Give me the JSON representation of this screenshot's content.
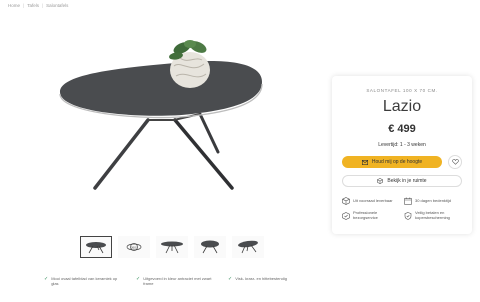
{
  "breadcrumb": [
    "Home",
    "Tafels",
    "Salontafels"
  ],
  "product": {
    "subtitle": "SALONTAFEL 100 X 70 CM.",
    "title": "Lazio",
    "price": "€ 499",
    "delivery": "Levertijd: 1 - 3 weken"
  },
  "actions": {
    "notify_label": "Houd mij op de hoogte",
    "room_label": "Bekijk in je ruimte"
  },
  "usps": [
    {
      "icon": "box-icon",
      "text": "Uit voorraad leverbaar"
    },
    {
      "icon": "calendar-icon",
      "text": "30 dagen bedenktijd"
    },
    {
      "icon": "delivery-icon",
      "text": "Professionele bezorgservice"
    },
    {
      "icon": "shield-icon",
      "text": "Veilig betalen en kopersbescherming"
    }
  ],
  "thumbnails": [
    {
      "alt": "Lazio salontafel",
      "active": true
    },
    {
      "alt": "360 view",
      "badge": "360°"
    },
    {
      "alt": "Lazio bovenaanzicht"
    },
    {
      "alt": "Lazio zijaanzicht"
    },
    {
      "alt": "Lazio schuin"
    }
  ],
  "features": [
    "Mooi ovaal tafelblad van keramiek op glas",
    "Uitgevoerd in kleur antraciet met zwart frame",
    "Visk- krasr- en hittebestendig"
  ],
  "colors": {
    "accent": "#f0b323",
    "check": "#2e8b57",
    "tabletop": "#4a4c4f"
  }
}
